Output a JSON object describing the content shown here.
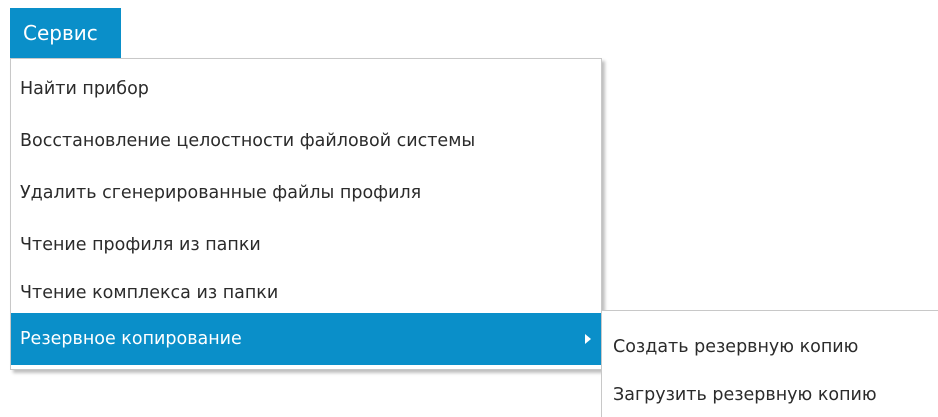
{
  "menubar": {
    "service_label": "Сервис"
  },
  "menu": {
    "items": [
      {
        "label": "Найти прибор"
      },
      {
        "label": "Восстановление целостности файловой системы"
      },
      {
        "label": "Удалить сгенерированные файлы профиля"
      },
      {
        "label": "Чтение профиля из папки"
      },
      {
        "label": "Чтение комплекса из папки"
      },
      {
        "label": "Резервное копирование",
        "has_submenu": true,
        "highlighted": true
      }
    ]
  },
  "submenu": {
    "items": [
      {
        "label": "Создать резервную копию"
      },
      {
        "label": "Загрузить резервную копию"
      }
    ]
  },
  "colors": {
    "accent": "#0a8fc9",
    "text": "#2b2b2b",
    "background": "#ffffff"
  },
  "icons": {
    "submenu_arrow": "chevron-right-icon"
  }
}
